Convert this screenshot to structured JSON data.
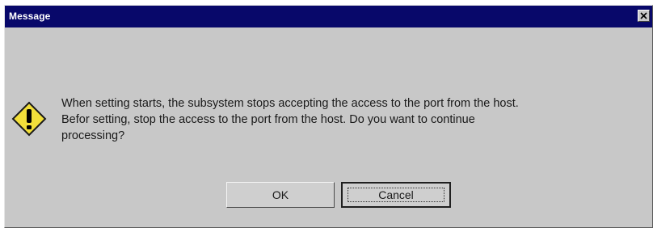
{
  "dialog": {
    "title": "Message",
    "icon": "warning-icon",
    "message": "When setting starts, the subsystem stops accepting the access to the port from the host. Befor setting, stop the access to the port from the host. Do you want to continue processing?",
    "message_lines": [
      "When setting starts, the subsystem stops accepting the access to the port from the host.",
      "Befor setting, stop the access to the port from the host. Do you want to continue",
      "processing?"
    ],
    "buttons": {
      "ok_label": "OK",
      "cancel_label": "Cancel"
    },
    "close_glyph": "×"
  },
  "colors": {
    "titlebar": "#08086a",
    "dialog_bg": "#c8c8c8",
    "warning_fill": "#f2df3a",
    "warning_mark": "#000000"
  }
}
